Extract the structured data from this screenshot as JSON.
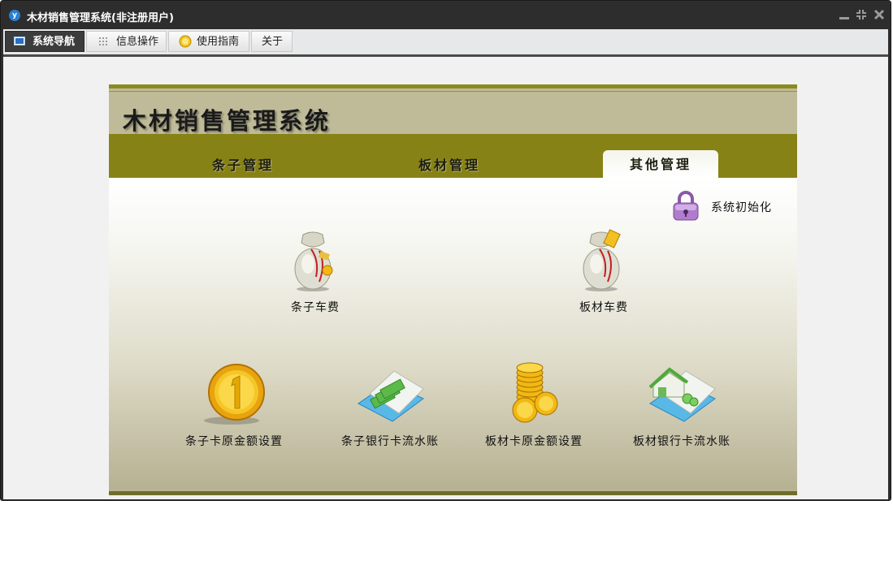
{
  "window": {
    "title": "木材销售管理系统(非注册用户)",
    "app_icon_letter": "y"
  },
  "menubar": {
    "tabs": [
      {
        "label": "系统导航",
        "icon": "monitor-icon",
        "active": true
      },
      {
        "label": "信息操作",
        "icon": "grid-icon",
        "active": false
      },
      {
        "label": "使用指南",
        "icon": "help-coin-icon",
        "active": false
      },
      {
        "label": "关于",
        "icon": "",
        "active": false
      }
    ]
  },
  "header": {
    "title": "木材销售管理系统"
  },
  "nav": {
    "tabs": [
      {
        "label": "条子管理",
        "active": false
      },
      {
        "label": "板材管理",
        "active": false
      },
      {
        "label": "其他管理",
        "active": true
      }
    ]
  },
  "init": {
    "label": "系统初始化",
    "icon": "lock-icon"
  },
  "items": [
    {
      "label": "条子车费",
      "icon": "money-bag-icon"
    },
    {
      "label": "板材车费",
      "icon": "money-bag-icon"
    },
    {
      "label": "条子卡原金额设置",
      "icon": "gold-coin-icon"
    },
    {
      "label": "条子银行卡流水账",
      "icon": "cash-ledger-icon"
    },
    {
      "label": "板材卡原金额设置",
      "icon": "coin-stack-icon"
    },
    {
      "label": "板材银行卡流水账",
      "icon": "house-ledger-icon"
    }
  ],
  "colors": {
    "header_bg": "#bfbb98",
    "nav_bg": "#878215",
    "titlebar_bg": "#2d2d2d"
  }
}
